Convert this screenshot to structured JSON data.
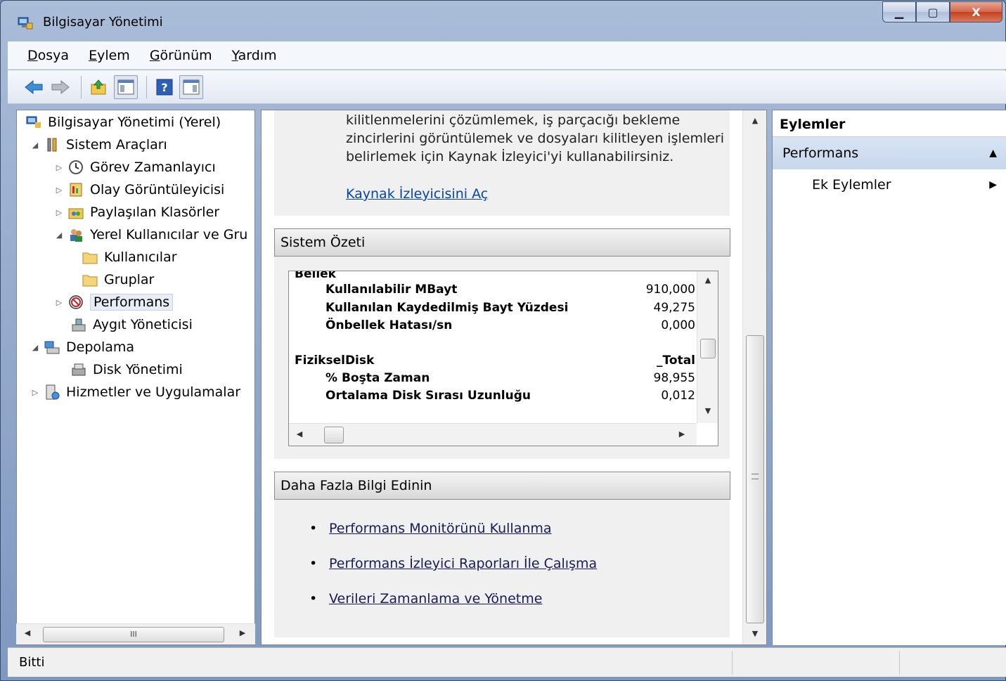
{
  "window": {
    "title": "Bilgisayar Yönetimi",
    "icon": "computer-management-icon"
  },
  "caption": {
    "minimize": "minimize-icon",
    "maximize": "maximize-icon",
    "close": "close-icon",
    "close_glyph": "X"
  },
  "menu": [
    {
      "label": "Dosya",
      "accel": "D",
      "rest": "osya"
    },
    {
      "label": "Eylem",
      "accel": "E",
      "rest": "ylem"
    },
    {
      "label": "Görünüm",
      "accel": "G",
      "rest": "örünüm"
    },
    {
      "label": "Yardım",
      "accel": "Y",
      "rest": "ardım"
    }
  ],
  "toolbar": [
    "back-arrow-icon",
    "forward-arrow-icon",
    "up-folder-icon",
    "show-hide-console-tree-icon",
    "help-icon",
    "show-hide-action-pane-icon"
  ],
  "tree": {
    "items": [
      {
        "label": "Bilgisayar Yönetimi (Yerel)",
        "icon": "computer-management-icon",
        "expander": ""
      },
      {
        "label": "Sistem Araçları",
        "icon": "tools-icon",
        "expander": "◢"
      },
      {
        "label": "Görev Zamanlayıcı",
        "icon": "clock-icon",
        "expander": "▷"
      },
      {
        "label": "Olay Görüntüleyicisi",
        "icon": "event-viewer-icon",
        "expander": "▷"
      },
      {
        "label": "Paylaşılan Klasörler",
        "icon": "shared-folders-icon",
        "expander": "▷"
      },
      {
        "label": "Yerel Kullanıcılar ve Gru",
        "icon": "users-icon",
        "expander": "◢"
      },
      {
        "label": "Kullanıcılar",
        "icon": "folder-icon",
        "expander": ""
      },
      {
        "label": "Gruplar",
        "icon": "folder-icon",
        "expander": ""
      },
      {
        "label": "Performans",
        "icon": "performance-icon",
        "expander": "▷"
      },
      {
        "label": "Aygıt Yöneticisi",
        "icon": "device-manager-icon",
        "expander": ""
      },
      {
        "label": "Depolama",
        "icon": "storage-icon",
        "expander": "◢"
      },
      {
        "label": "Disk Yönetimi",
        "icon": "disk-management-icon",
        "expander": ""
      },
      {
        "label": "Hizmetler ve Uygulamalar",
        "icon": "services-icon",
        "expander": "▷"
      }
    ],
    "hscroll_thumb_grip": "III"
  },
  "center": {
    "intro_text": "kilitlenmelerini çözümlemek, iş parçacığı bekleme zincirlerini görüntülemek ve dosyaları kilitleyen işlemleri belirlemek için Kaynak İzleyici'yi kullanabilirsiniz.",
    "open_link": "Kaynak İzleyicisini Aç",
    "summary_header": "Sistem Özeti",
    "summary": {
      "group1_title": "Bellek",
      "group1_rows": [
        {
          "label": "Kullanılabilir MBayt",
          "value": "910,000"
        },
        {
          "label": "Kullanılan Kaydedilmiş Bayt Yüzdesi",
          "value": "49,275"
        },
        {
          "label": "Önbellek Hatası/sn",
          "value": "0,000"
        }
      ],
      "group2_title": "FizikselDisk",
      "group2_instance": "_Total",
      "group2_rows": [
        {
          "label": "% Boşta Zaman",
          "value": "98,955"
        },
        {
          "label": "Ortalama Disk Sırası Uzunluğu",
          "value": "0,012"
        }
      ]
    },
    "more_header": "Daha Fazla Bilgi Edinin",
    "more_links": [
      "Performans Monitörünü Kullanma",
      "Performans İzleyici Raporları İle Çalışma",
      "Verileri Zamanlama ve Yönetme"
    ]
  },
  "actions": {
    "header": "Eylemler",
    "section": "Performans",
    "items": [
      "Ek Eylemler"
    ]
  },
  "status": {
    "text": "Bitti"
  }
}
